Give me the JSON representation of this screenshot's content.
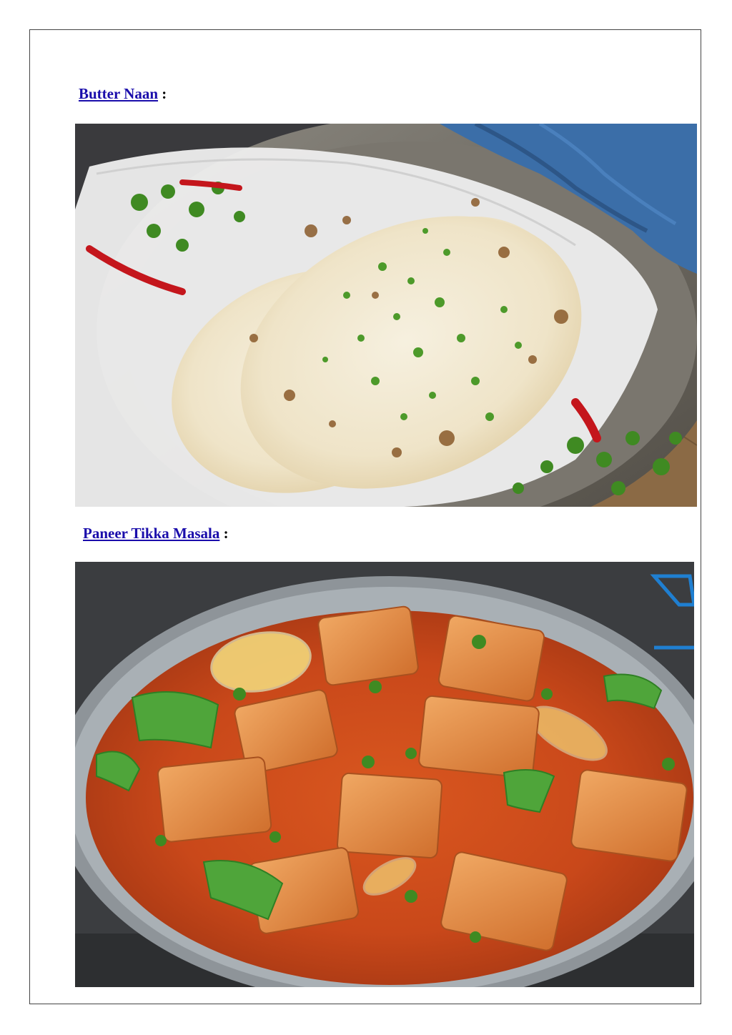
{
  "sections": [
    {
      "link_text": "Butter Naan",
      "suffix": " :",
      "image_subject": "butter-naan-photo"
    },
    {
      "link_text": "Paneer Tikka Masala",
      "suffix": " :",
      "image_subject": "paneer-tikka-masala-photo"
    }
  ],
  "colors": {
    "link": "#1a0dab",
    "frame": "#444444"
  }
}
